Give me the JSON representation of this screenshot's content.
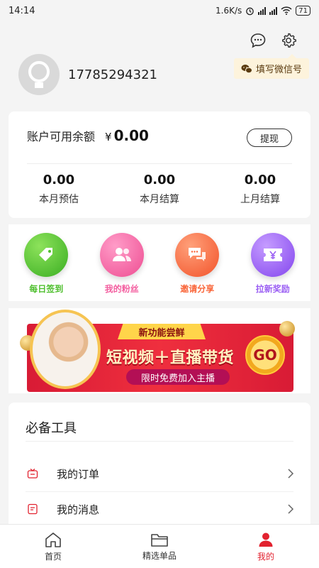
{
  "status_bar": {
    "time": "14:14",
    "net_speed": "1.6K/s",
    "battery": "71"
  },
  "header": {
    "wechat_tip": "填写微信号"
  },
  "profile": {
    "phone": "17785294321"
  },
  "balance": {
    "label": "账户可用余额",
    "currency": "¥",
    "amount": "0.00",
    "withdraw_label": "提现",
    "stats": [
      {
        "value": "0.00",
        "label": "本月预估"
      },
      {
        "value": "0.00",
        "label": "本月结算"
      },
      {
        "value": "0.00",
        "label": "上月结算"
      }
    ]
  },
  "features": [
    {
      "label": "每日签到",
      "icon": "tag-icon",
      "color": "#4fbf2e",
      "label_color": "#4fbf2e"
    },
    {
      "label": "我的粉丝",
      "icon": "fans-icon",
      "color": "#f35fa0",
      "label_color": "#f35fa0"
    },
    {
      "label": "邀请分享",
      "icon": "chat-bubbles-icon",
      "color": "#f9663a",
      "label_color": "#f9663a"
    },
    {
      "label": "拉新奖励",
      "icon": "ticket-icon",
      "color": "#9a5ef3",
      "label_color": "#9a5ef3"
    }
  ],
  "banner": {
    "tag": "新功能尝鲜",
    "title": "短视频＋直播带货",
    "subtitle": "限时免费加入主播",
    "go": "GO"
  },
  "tools": {
    "title": "必备工具",
    "items": [
      {
        "label": "我的订单",
        "icon": "tv-icon"
      },
      {
        "label": "我的消息",
        "icon": "message-doc-icon"
      }
    ]
  },
  "tabbar": {
    "items": [
      {
        "label": "首页",
        "icon": "home-icon"
      },
      {
        "label": "精选单品",
        "icon": "folder-icon"
      },
      {
        "label": "我的",
        "icon": "user-icon"
      }
    ],
    "active": "我的",
    "active_color": "#e2222f"
  }
}
